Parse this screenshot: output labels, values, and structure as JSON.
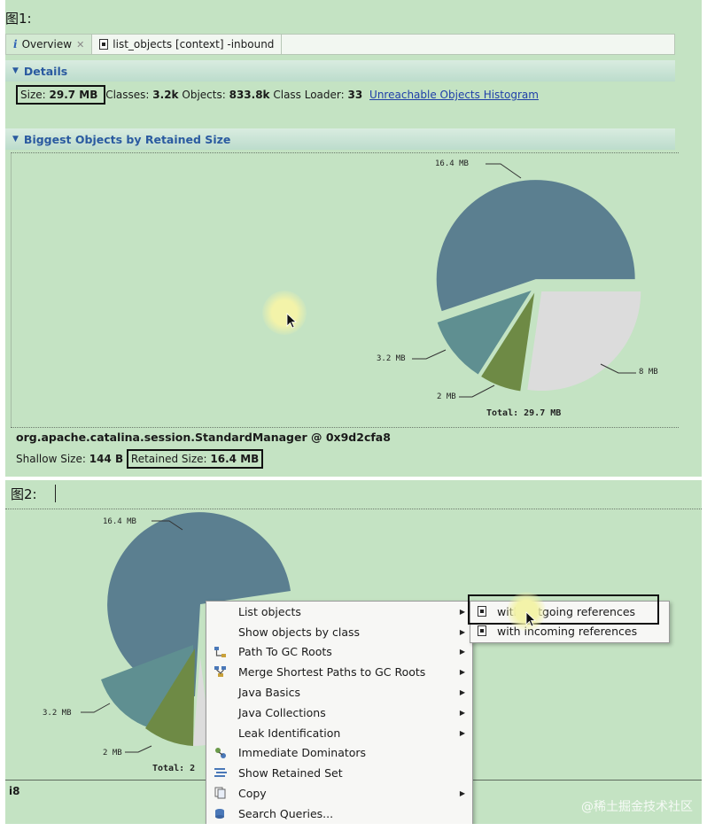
{
  "figure1": {
    "label": "图1:",
    "tabs": [
      {
        "label": "Overview",
        "active": true
      },
      {
        "label": "list_objects [context] -inbound",
        "active": false
      }
    ],
    "details": {
      "header": "Details",
      "size_label": "Size:",
      "size_value": "29.7 MB",
      "classes_label": "Classes:",
      "classes_value": "3.2k",
      "objects_label": "Objects:",
      "objects_value": "833.8k",
      "loader_label": "Class Loader:",
      "loader_value": "33",
      "histogram_link": "Unreachable Objects Histogram"
    },
    "biggest_header": "Biggest Objects by Retained Size",
    "chart_data": {
      "type": "pie",
      "slices": [
        {
          "label": "16.4 MB",
          "value": 16.4,
          "color": "#5b7f90"
        },
        {
          "label": "8 MB",
          "value": 8.1,
          "color": "#dcdcdc"
        },
        {
          "label": "2 MB",
          "value": 2.0,
          "color": "#6e8a45"
        },
        {
          "label": "3.2 MB",
          "value": 3.2,
          "color": "#5f8f91"
        }
      ],
      "total_label": "Total: 29.7 MB"
    },
    "object": {
      "name": "org.apache.catalina.session.StandardManager @ 0x9d2cfa8",
      "shallow_label": "Shallow Size:",
      "shallow_value": "144 B",
      "retained_label": "Retained Size:",
      "retained_value": "16.4 MB"
    }
  },
  "figure2": {
    "label": "图2:",
    "pie_labels": {
      "big": "16.4 MB",
      "mid": "3.2 MB",
      "small": "2 MB",
      "total": "Total: 2"
    },
    "fragment": "i8",
    "context_menu": [
      {
        "label": "List objects",
        "submenu": true,
        "icon": ""
      },
      {
        "label": "Show objects by class",
        "submenu": true,
        "icon": ""
      },
      {
        "label": "Path To GC Roots",
        "submenu": true,
        "icon": "path-icon"
      },
      {
        "label": "Merge Shortest Paths to GC Roots",
        "submenu": true,
        "icon": "merge-icon"
      },
      {
        "label": "Java Basics",
        "submenu": true,
        "icon": ""
      },
      {
        "label": "Java Collections",
        "submenu": true,
        "icon": ""
      },
      {
        "label": "Leak Identification",
        "submenu": true,
        "icon": ""
      },
      {
        "label": "Immediate Dominators",
        "submenu": false,
        "icon": "dominator-icon"
      },
      {
        "label": "Show Retained Set",
        "submenu": false,
        "icon": "retained-icon"
      },
      {
        "label": "Copy",
        "submenu": true,
        "icon": "copy-icon"
      },
      {
        "label": "Search Queries...",
        "submenu": false,
        "icon": "search-icon"
      }
    ],
    "submenu": [
      {
        "label": "with outgoing references"
      },
      {
        "label": "with incoming references"
      }
    ]
  },
  "watermark": "@稀土掘金技术社区"
}
